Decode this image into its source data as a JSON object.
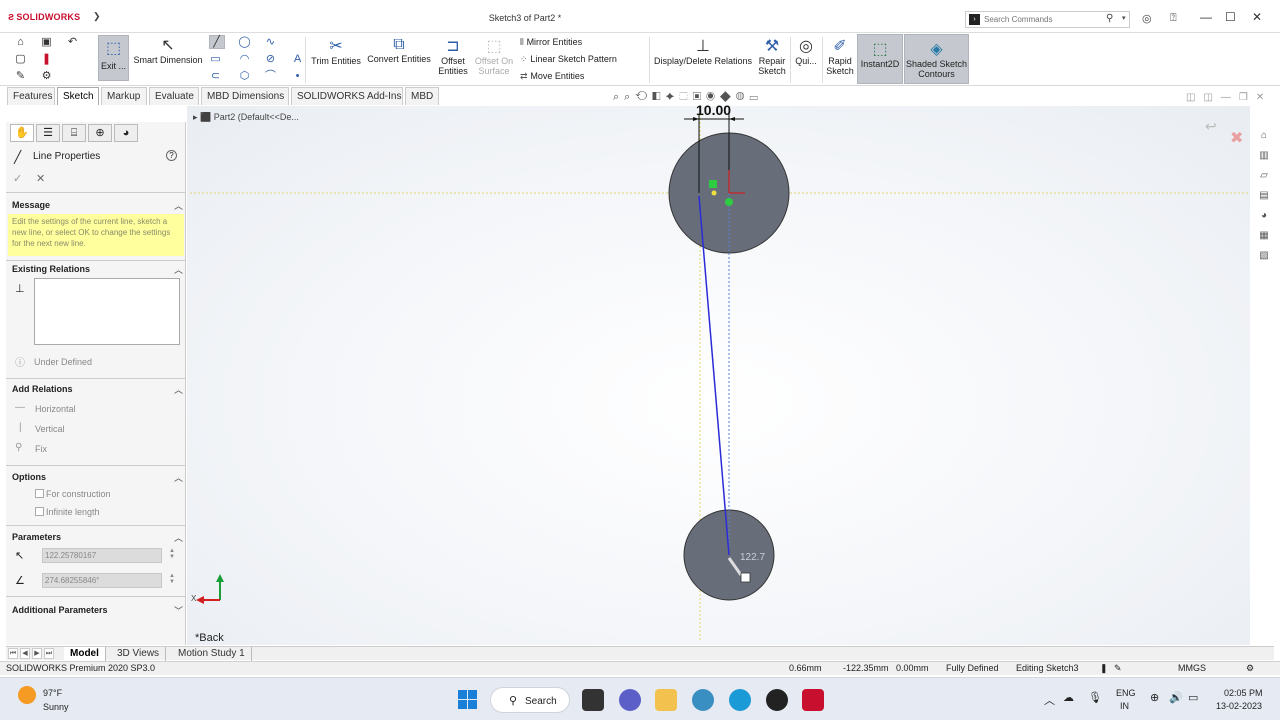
{
  "app": {
    "logo_text": "SOLIDWORKS",
    "doc_title": "Sketch3 of Part2 *",
    "search_placeholder": "Search Commands"
  },
  "toolbar": {
    "exit_sketch": "Exit ...",
    "smart_dimension": "Smart Dimension",
    "trim_entities": "Trim Entities",
    "convert_entities": "Convert Entities",
    "offset_entities_1": "Offset",
    "offset_entities_2": "Entities",
    "offset_on_surface_1": "Offset On",
    "offset_on_surface_2": "Surface",
    "mirror_entities": "Mirror Entities",
    "linear_sketch_pattern": "Linear Sketch Pattern",
    "move_entities": "Move Entities",
    "display_delete_relations": "Display/Delete Relations",
    "repair_sketch_1": "Repair",
    "repair_sketch_2": "Sketch",
    "quick_snaps": "Qui...",
    "rapid_sketch_1": "Rapid",
    "rapid_sketch_2": "Sketch",
    "instant2d": "Instant2D",
    "shaded_sketch_1": "Shaded Sketch",
    "shaded_sketch_2": "Contours"
  },
  "tabs": [
    "Features",
    "Sketch",
    "Markup",
    "Evaluate",
    "MBD Dimensions",
    "SOLIDWORKS Add-Ins",
    "MBD"
  ],
  "pm": {
    "title": "Line Properties",
    "help": "?",
    "ok": "✓",
    "cancel": "✕",
    "message_header": "Message",
    "message_text": "Edit the settings of the current line, sketch a new line, or select OK to change the settings for the next new line.",
    "existing_relations_header": "Existing Relations",
    "under_defined": "Under Defined",
    "add_relations_header": "Add Relations",
    "relation_horizontal": "Horizontal",
    "relation_vertical": "Vertical",
    "relation_fix": "Fix",
    "options_header": "Options",
    "option_construction": "For construction",
    "option_infinite": "Infinite length",
    "parameters_header": "Parameters",
    "param_length": "122.25780167",
    "param_angle": "274.68255846°",
    "additional_header": "Additional Parameters"
  },
  "tree": {
    "part_label": "Part2  (Default<<De..."
  },
  "canvas": {
    "dimension": "10.00",
    "length_readout": "122.7",
    "back_label": "*Back"
  },
  "bottom_tabs": [
    "Model",
    "3D Views",
    "Motion Study 1"
  ],
  "status": {
    "version": "SOLIDWORKS Premium 2020 SP3.0",
    "x": "0.66mm",
    "y": "-122.35mm",
    "z": "0.00mm",
    "defined": "Fully Defined",
    "editing": "Editing Sketch3",
    "units": "MMGS"
  },
  "taskbar": {
    "temperature": "97°F",
    "weather": "Sunny",
    "search": "Search",
    "lang1": "ENG",
    "lang2": "IN",
    "time": "02:05 PM",
    "date": "13-02-2023"
  },
  "colors": {
    "accent": "#2d5ea8",
    "message_bg": "#ffff9d",
    "circle_fill": "#676e7a",
    "sketch_line": "#2c2cd6"
  }
}
